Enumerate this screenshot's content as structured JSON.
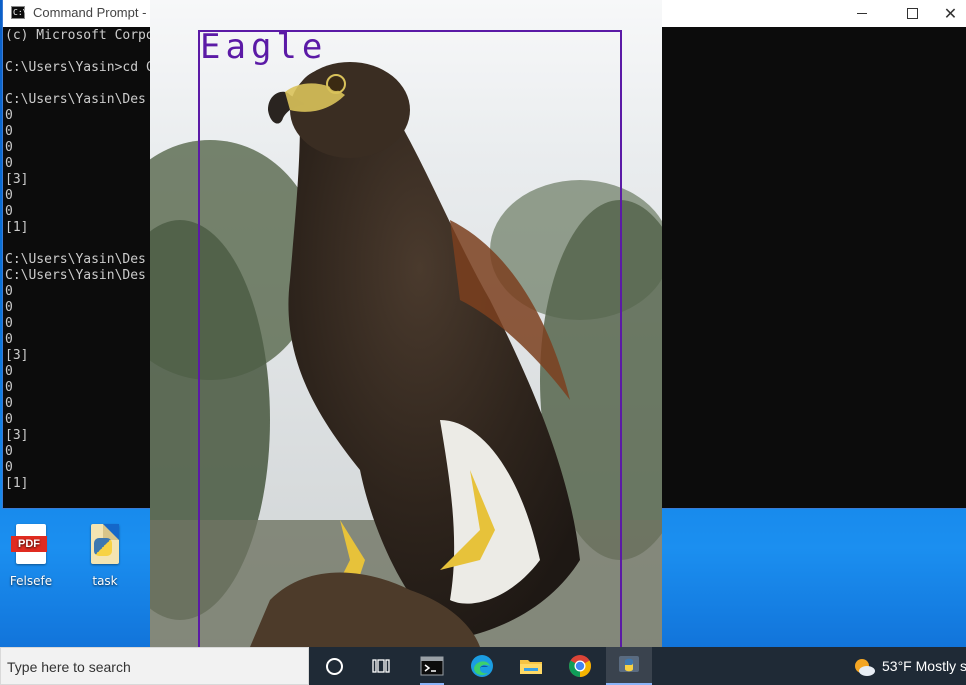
{
  "cmd": {
    "title": "Command Prompt - p",
    "icon_name": "cmd-icon",
    "lines": [
      "(c) Microsoft Corpo",
      "",
      "C:\\Users\\Yasin>cd C",
      "",
      "C:\\Users\\Yasin\\Des",
      "0",
      "0",
      "0",
      "0",
      "[3]",
      "0",
      "0",
      "[1]",
      "",
      "C:\\Users\\Yasin\\Des",
      "C:\\Users\\Yasin\\Des",
      "0",
      "0",
      "0",
      "0",
      "[3]",
      "0",
      "0",
      "0",
      "0",
      "[3]",
      "0",
      "0",
      "[1]"
    ],
    "controls": {
      "minimize": "minimize-icon",
      "maximize": "maximize-icon",
      "close": "close-icon"
    }
  },
  "viewer": {
    "detection_label": "Eagle",
    "box_color": "#5b1aa6"
  },
  "desktop": {
    "icons": [
      {
        "label": "Felsefe",
        "icon": "pdf-file-icon",
        "badge": "PDF"
      },
      {
        "label": "task",
        "icon": "python-file-icon"
      }
    ]
  },
  "taskbar": {
    "search_placeholder": "Type here to search",
    "apps": [
      "cortana-icon",
      "task-view-icon",
      "terminal-icon",
      "edge-icon",
      "file-explorer-icon",
      "chrome-icon",
      "python-icon"
    ],
    "weather": {
      "temp": "53°F",
      "summary": "Mostly s",
      "icon": "partly-sunny-icon"
    }
  }
}
